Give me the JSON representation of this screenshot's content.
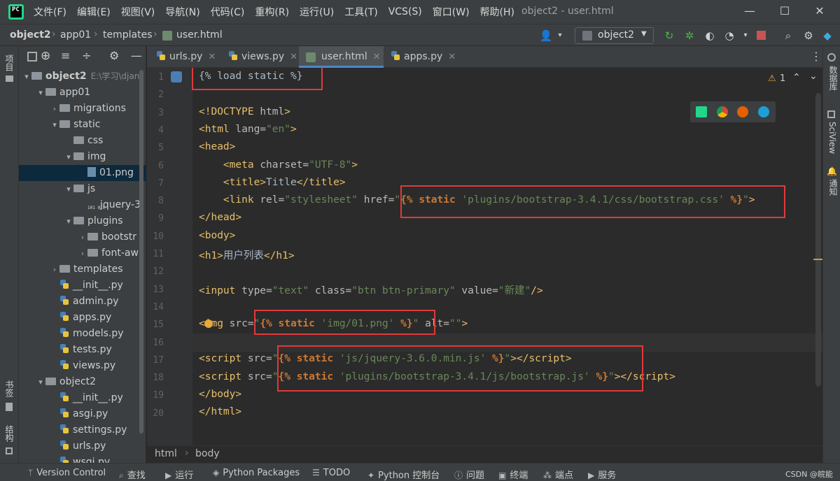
{
  "app": {
    "logo_text": "PC",
    "window_title": "object2 - user.html",
    "menu": [
      "文件(F)",
      "编辑(E)",
      "视图(V)",
      "导航(N)",
      "代码(C)",
      "重构(R)",
      "运行(U)",
      "工具(T)",
      "VCS(S)",
      "窗口(W)",
      "帮助(H)"
    ]
  },
  "navbar": {
    "breadcrumbs": [
      "object2",
      "app01",
      "templates",
      "user.html"
    ],
    "run_config": "object2"
  },
  "left_strip": {
    "project_label": "项目",
    "bookmarks_label": "书签",
    "structure_label": "结构"
  },
  "project_tree": {
    "rows": [
      {
        "label": "object2",
        "extra": "E:\\学习\\djan",
        "kind": "folder",
        "arrow": "▾"
      },
      {
        "label": "app01",
        "kind": "folder",
        "arrow": "▾"
      },
      {
        "label": "migrations",
        "kind": "folder",
        "arrow": "›"
      },
      {
        "label": "static",
        "kind": "folder",
        "arrow": "▾"
      },
      {
        "label": "css",
        "kind": "folder",
        "arrow": ""
      },
      {
        "label": "img",
        "kind": "folder",
        "arrow": "▾"
      },
      {
        "label": "01.png",
        "kind": "img",
        "arrow": ""
      },
      {
        "label": "js",
        "kind": "folder",
        "arrow": "▾"
      },
      {
        "label": "jquery-3",
        "kind": "js",
        "arrow": ""
      },
      {
        "label": "plugins",
        "kind": "folder",
        "arrow": "▾"
      },
      {
        "label": "bootstr",
        "kind": "folder",
        "arrow": "›"
      },
      {
        "label": "font-aw",
        "kind": "folder",
        "arrow": "›"
      },
      {
        "label": "templates",
        "kind": "folder",
        "arrow": "›"
      },
      {
        "label": "__init__.py",
        "kind": "py",
        "arrow": ""
      },
      {
        "label": "admin.py",
        "kind": "py",
        "arrow": ""
      },
      {
        "label": "apps.py",
        "kind": "py",
        "arrow": ""
      },
      {
        "label": "models.py",
        "kind": "py",
        "arrow": ""
      },
      {
        "label": "tests.py",
        "kind": "py",
        "arrow": ""
      },
      {
        "label": "views.py",
        "kind": "py",
        "arrow": ""
      },
      {
        "label": "object2",
        "kind": "folder",
        "arrow": "▾"
      },
      {
        "label": "__init__.py",
        "kind": "py",
        "arrow": ""
      },
      {
        "label": "asgi.py",
        "kind": "py",
        "arrow": ""
      },
      {
        "label": "settings.py",
        "kind": "py",
        "arrow": ""
      },
      {
        "label": "urls.py",
        "kind": "py",
        "arrow": ""
      },
      {
        "label": "wsgi.py",
        "kind": "py",
        "arrow": ""
      }
    ]
  },
  "tabs": [
    {
      "label": "urls.py"
    },
    {
      "label": "views.py"
    },
    {
      "label": "user.html"
    },
    {
      "label": "apps.py"
    }
  ],
  "editor": {
    "warning_count": "1",
    "line_numbers": [
      "1",
      "2",
      "3",
      "4",
      "5",
      "6",
      "7",
      "8",
      "9",
      "10",
      "11",
      "12",
      "13",
      "14",
      "15",
      "16",
      "17",
      "18",
      "19",
      "20"
    ]
  },
  "right_strip": {
    "database_label": "数据库",
    "sciview_label": "SciView",
    "notifications_label": "通知"
  },
  "code_breadcrumb": [
    "html",
    "body"
  ],
  "statusbar": {
    "items": [
      "Version Control",
      "查找",
      "运行",
      "Python Packages",
      "TODO",
      "Python 控制台",
      "问题",
      "终端",
      "端点",
      "服务"
    ],
    "watermark": "CSDN @皖能"
  }
}
